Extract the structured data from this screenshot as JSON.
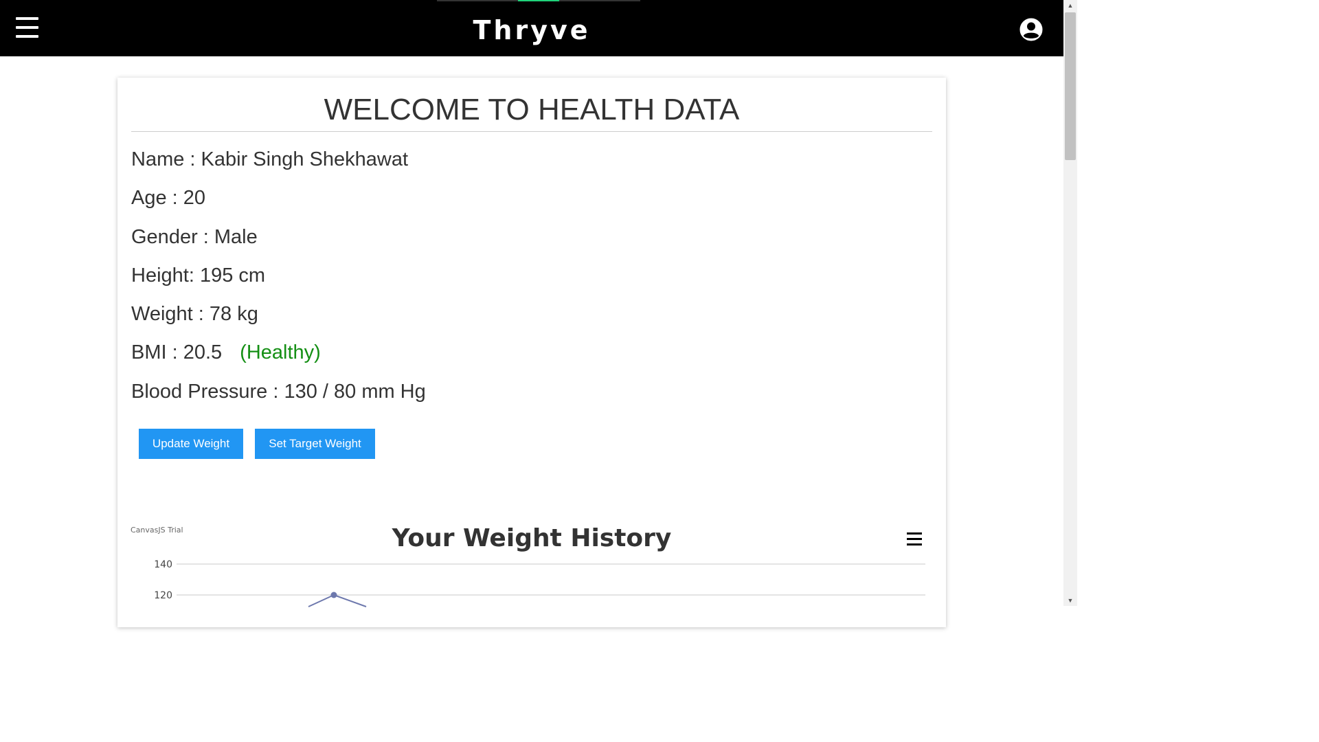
{
  "header": {
    "brand": "Thryve",
    "menu_icon": "hamburger-menu-icon",
    "account_icon": "user-account-icon",
    "bar_color": "#000000",
    "accent_color": "#1fd27a"
  },
  "health": {
    "title": "WELCOME TO HEALTH DATA",
    "name_line": "Name : Kabir Singh Shekhawat",
    "age_line": "Age : 20",
    "gender_line": "Gender : Male",
    "height_line": "Height: 195 cm",
    "weight_line": "Weight : 78 kg",
    "bmi_line": "BMI : 20.5",
    "bmi_status": "(Healthy)",
    "bmi_status_color": "#148f14",
    "bp_line": "Blood Pressure : 130 / 80 mm Hg"
  },
  "actions": {
    "update_weight": "Update Weight",
    "set_target_weight": "Set Target Weight",
    "button_color": "#2196f3"
  },
  "chart": {
    "credit": "CanvasJS Trial",
    "menu_icon": "chart-menu-icon"
  },
  "chart_data": {
    "type": "line",
    "title": "Your Weight History",
    "xlabel": "",
    "ylabel": "",
    "y_ticks": [
      140,
      120
    ],
    "ylim_visible": [
      120,
      140
    ],
    "grid": true,
    "series": [
      {
        "values": [
          120
        ],
        "color": "#6d78ad"
      }
    ]
  }
}
